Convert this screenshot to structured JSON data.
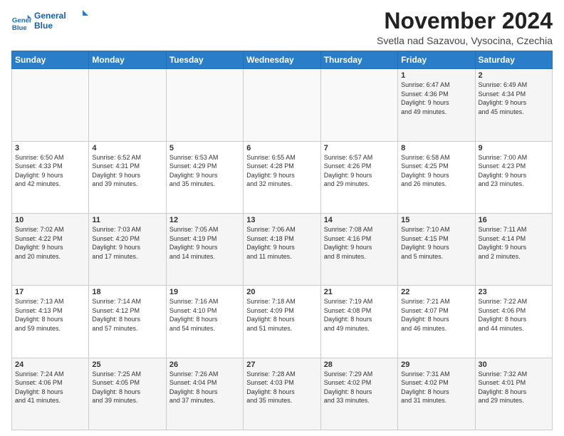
{
  "header": {
    "logo_line1": "General",
    "logo_line2": "Blue",
    "month_title": "November 2024",
    "location": "Svetla nad Sazavou, Vysocina, Czechia"
  },
  "days_of_week": [
    "Sunday",
    "Monday",
    "Tuesday",
    "Wednesday",
    "Thursday",
    "Friday",
    "Saturday"
  ],
  "weeks": [
    [
      {
        "day": "",
        "info": ""
      },
      {
        "day": "",
        "info": ""
      },
      {
        "day": "",
        "info": ""
      },
      {
        "day": "",
        "info": ""
      },
      {
        "day": "",
        "info": ""
      },
      {
        "day": "1",
        "info": "Sunrise: 6:47 AM\nSunset: 4:36 PM\nDaylight: 9 hours\nand 49 minutes."
      },
      {
        "day": "2",
        "info": "Sunrise: 6:49 AM\nSunset: 4:34 PM\nDaylight: 9 hours\nand 45 minutes."
      }
    ],
    [
      {
        "day": "3",
        "info": "Sunrise: 6:50 AM\nSunset: 4:33 PM\nDaylight: 9 hours\nand 42 minutes."
      },
      {
        "day": "4",
        "info": "Sunrise: 6:52 AM\nSunset: 4:31 PM\nDaylight: 9 hours\nand 39 minutes."
      },
      {
        "day": "5",
        "info": "Sunrise: 6:53 AM\nSunset: 4:29 PM\nDaylight: 9 hours\nand 35 minutes."
      },
      {
        "day": "6",
        "info": "Sunrise: 6:55 AM\nSunset: 4:28 PM\nDaylight: 9 hours\nand 32 minutes."
      },
      {
        "day": "7",
        "info": "Sunrise: 6:57 AM\nSunset: 4:26 PM\nDaylight: 9 hours\nand 29 minutes."
      },
      {
        "day": "8",
        "info": "Sunrise: 6:58 AM\nSunset: 4:25 PM\nDaylight: 9 hours\nand 26 minutes."
      },
      {
        "day": "9",
        "info": "Sunrise: 7:00 AM\nSunset: 4:23 PM\nDaylight: 9 hours\nand 23 minutes."
      }
    ],
    [
      {
        "day": "10",
        "info": "Sunrise: 7:02 AM\nSunset: 4:22 PM\nDaylight: 9 hours\nand 20 minutes."
      },
      {
        "day": "11",
        "info": "Sunrise: 7:03 AM\nSunset: 4:20 PM\nDaylight: 9 hours\nand 17 minutes."
      },
      {
        "day": "12",
        "info": "Sunrise: 7:05 AM\nSunset: 4:19 PM\nDaylight: 9 hours\nand 14 minutes."
      },
      {
        "day": "13",
        "info": "Sunrise: 7:06 AM\nSunset: 4:18 PM\nDaylight: 9 hours\nand 11 minutes."
      },
      {
        "day": "14",
        "info": "Sunrise: 7:08 AM\nSunset: 4:16 PM\nDaylight: 9 hours\nand 8 minutes."
      },
      {
        "day": "15",
        "info": "Sunrise: 7:10 AM\nSunset: 4:15 PM\nDaylight: 9 hours\nand 5 minutes."
      },
      {
        "day": "16",
        "info": "Sunrise: 7:11 AM\nSunset: 4:14 PM\nDaylight: 9 hours\nand 2 minutes."
      }
    ],
    [
      {
        "day": "17",
        "info": "Sunrise: 7:13 AM\nSunset: 4:13 PM\nDaylight: 8 hours\nand 59 minutes."
      },
      {
        "day": "18",
        "info": "Sunrise: 7:14 AM\nSunset: 4:12 PM\nDaylight: 8 hours\nand 57 minutes."
      },
      {
        "day": "19",
        "info": "Sunrise: 7:16 AM\nSunset: 4:10 PM\nDaylight: 8 hours\nand 54 minutes."
      },
      {
        "day": "20",
        "info": "Sunrise: 7:18 AM\nSunset: 4:09 PM\nDaylight: 8 hours\nand 51 minutes."
      },
      {
        "day": "21",
        "info": "Sunrise: 7:19 AM\nSunset: 4:08 PM\nDaylight: 8 hours\nand 49 minutes."
      },
      {
        "day": "22",
        "info": "Sunrise: 7:21 AM\nSunset: 4:07 PM\nDaylight: 8 hours\nand 46 minutes."
      },
      {
        "day": "23",
        "info": "Sunrise: 7:22 AM\nSunset: 4:06 PM\nDaylight: 8 hours\nand 44 minutes."
      }
    ],
    [
      {
        "day": "24",
        "info": "Sunrise: 7:24 AM\nSunset: 4:06 PM\nDaylight: 8 hours\nand 41 minutes."
      },
      {
        "day": "25",
        "info": "Sunrise: 7:25 AM\nSunset: 4:05 PM\nDaylight: 8 hours\nand 39 minutes."
      },
      {
        "day": "26",
        "info": "Sunrise: 7:26 AM\nSunset: 4:04 PM\nDaylight: 8 hours\nand 37 minutes."
      },
      {
        "day": "27",
        "info": "Sunrise: 7:28 AM\nSunset: 4:03 PM\nDaylight: 8 hours\nand 35 minutes."
      },
      {
        "day": "28",
        "info": "Sunrise: 7:29 AM\nSunset: 4:02 PM\nDaylight: 8 hours\nand 33 minutes."
      },
      {
        "day": "29",
        "info": "Sunrise: 7:31 AM\nSunset: 4:02 PM\nDaylight: 8 hours\nand 31 minutes."
      },
      {
        "day": "30",
        "info": "Sunrise: 7:32 AM\nSunset: 4:01 PM\nDaylight: 8 hours\nand 29 minutes."
      }
    ]
  ]
}
